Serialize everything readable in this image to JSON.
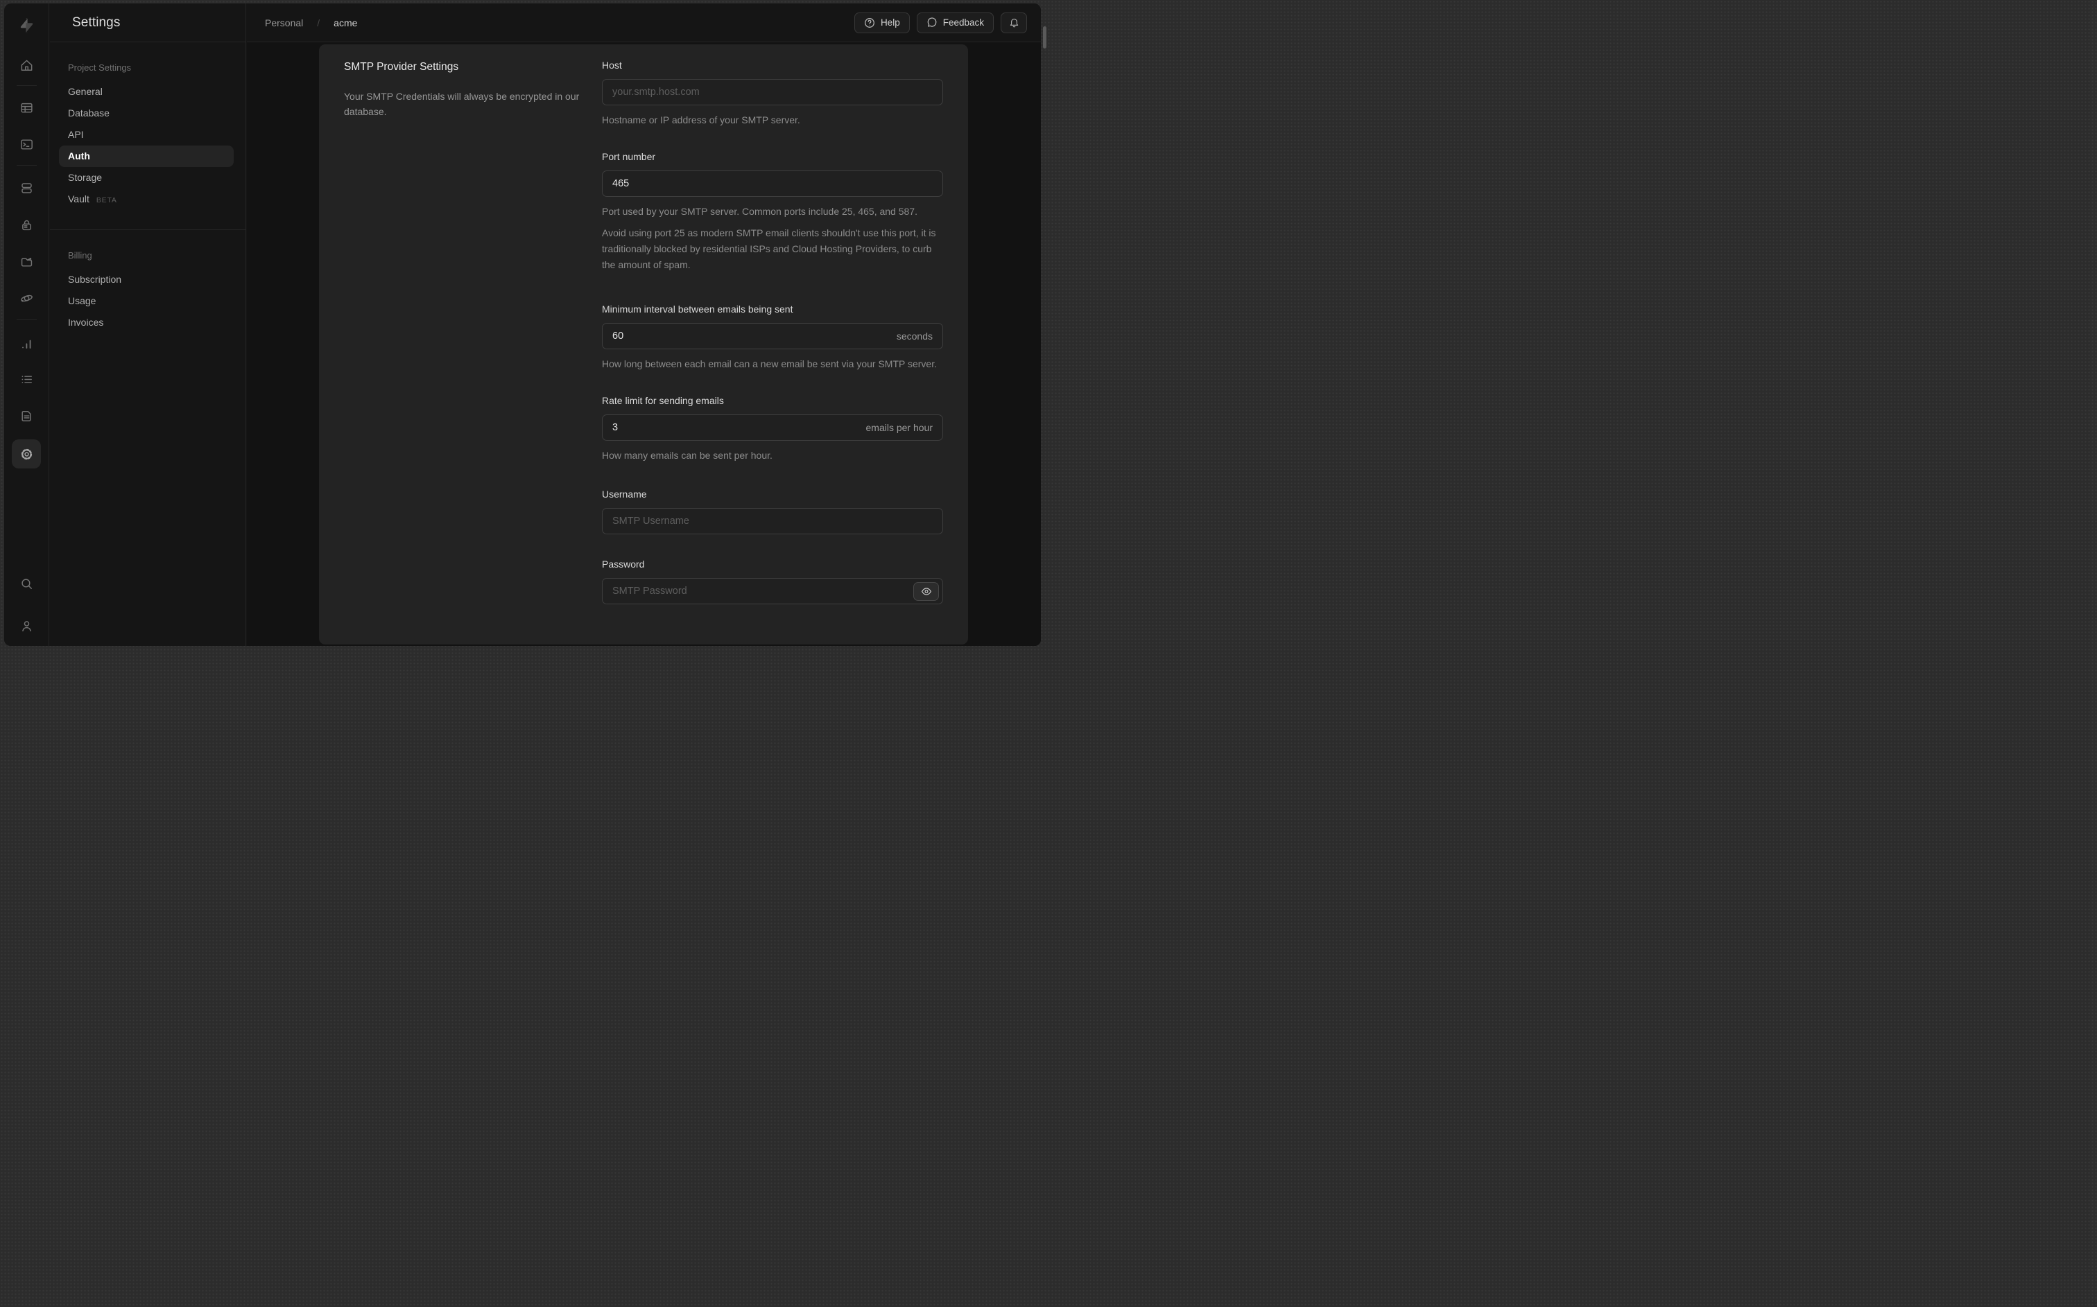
{
  "window_title": "Settings",
  "header": {
    "breadcrumb": {
      "org": "Personal",
      "separator": "/",
      "project": "acme"
    },
    "help_label": "Help",
    "feedback_label": "Feedback"
  },
  "rail": {
    "items": [
      "home",
      "table-editor",
      "sql-editor",
      "database",
      "authentication",
      "storage",
      "edge-functions",
      "reports",
      "logs",
      "docs",
      "project-settings",
      "search",
      "user"
    ],
    "active_item": "project-settings"
  },
  "sidebar": {
    "title": "Settings",
    "sections": [
      {
        "heading": "Project Settings",
        "items": [
          {
            "label": "General"
          },
          {
            "label": "Database"
          },
          {
            "label": "API"
          },
          {
            "label": "Auth",
            "active": true
          },
          {
            "label": "Storage"
          },
          {
            "label": "Vault",
            "badge": "BETA"
          }
        ]
      },
      {
        "heading": "Billing",
        "items": [
          {
            "label": "Subscription"
          },
          {
            "label": "Usage"
          },
          {
            "label": "Invoices"
          }
        ]
      }
    ]
  },
  "main": {
    "section_title": "SMTP Provider Settings",
    "section_description": "Your SMTP Credentials will always be encrypted in our database.",
    "fields": {
      "host": {
        "label": "Host",
        "placeholder": "your.smtp.host.com",
        "helper": "Hostname or IP address of your SMTP server."
      },
      "port": {
        "label": "Port number",
        "value": "465",
        "helper": "Port used by your SMTP server. Common ports include 25, 465, and 587.",
        "helper2": "Avoid using port 25 as modern SMTP email clients shouldn't use this port, it is traditionally blocked by residential ISPs and Cloud Hosting Providers, to curb the amount of spam."
      },
      "interval": {
        "label": "Minimum interval between emails being sent",
        "value": "60",
        "suffix": "seconds",
        "helper": "How long between each email can a new email be sent via your SMTP server."
      },
      "rate": {
        "label": "Rate limit for sending emails",
        "value": "3",
        "suffix": "emails per hour",
        "helper": "How many emails can be sent per hour."
      },
      "username": {
        "label": "Username",
        "placeholder": "SMTP Username"
      },
      "password": {
        "label": "Password",
        "placeholder": "SMTP Password"
      }
    }
  },
  "colors": {
    "frame_bg": "#2c2c2c",
    "window_bg": "#151515",
    "content_bg": "#121212",
    "card_bg": "#232323",
    "input_bg": "#202020",
    "input_border": "#3e3e3e",
    "text_primary": "#e3e3e3",
    "text_secondary": "#8e8e8e",
    "active_pill": "rgba(255,255,255,0.065)"
  }
}
